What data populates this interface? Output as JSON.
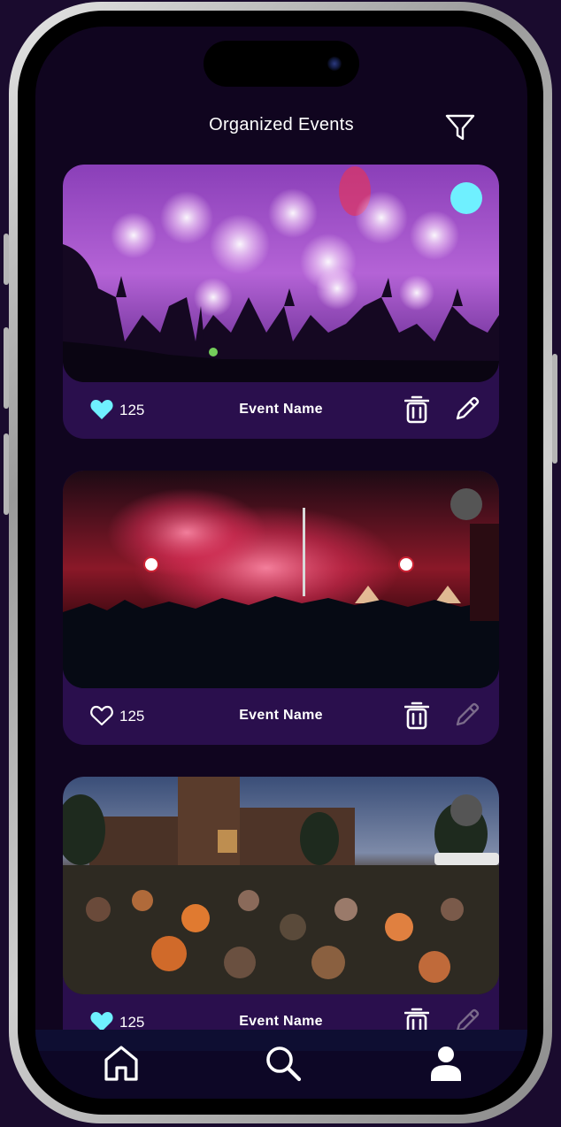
{
  "header": {
    "title": "Organized Events"
  },
  "icons": {
    "filter": "filter-icon",
    "heart": "heart-icon",
    "trash": "trash-icon",
    "pencil": "pencil-icon",
    "home": "home-icon",
    "search": "search-icon",
    "profile": "profile-icon"
  },
  "colors": {
    "background": "#10051f",
    "card": "#2a0f4d",
    "accent": "#6ff0ff",
    "inactive_dot": "#555555"
  },
  "events": [
    {
      "name": "Event Name",
      "likes": "125",
      "liked": true,
      "selected": true,
      "photo": "fireworks-concert-purple"
    },
    {
      "name": "Event Name",
      "likes": "125",
      "liked": false,
      "selected": false,
      "photo": "red-flare-crowd-night"
    },
    {
      "name": "Event Name",
      "likes": "125",
      "liked": true,
      "selected": false,
      "photo": "crowd-on-campus-lawn"
    }
  ]
}
